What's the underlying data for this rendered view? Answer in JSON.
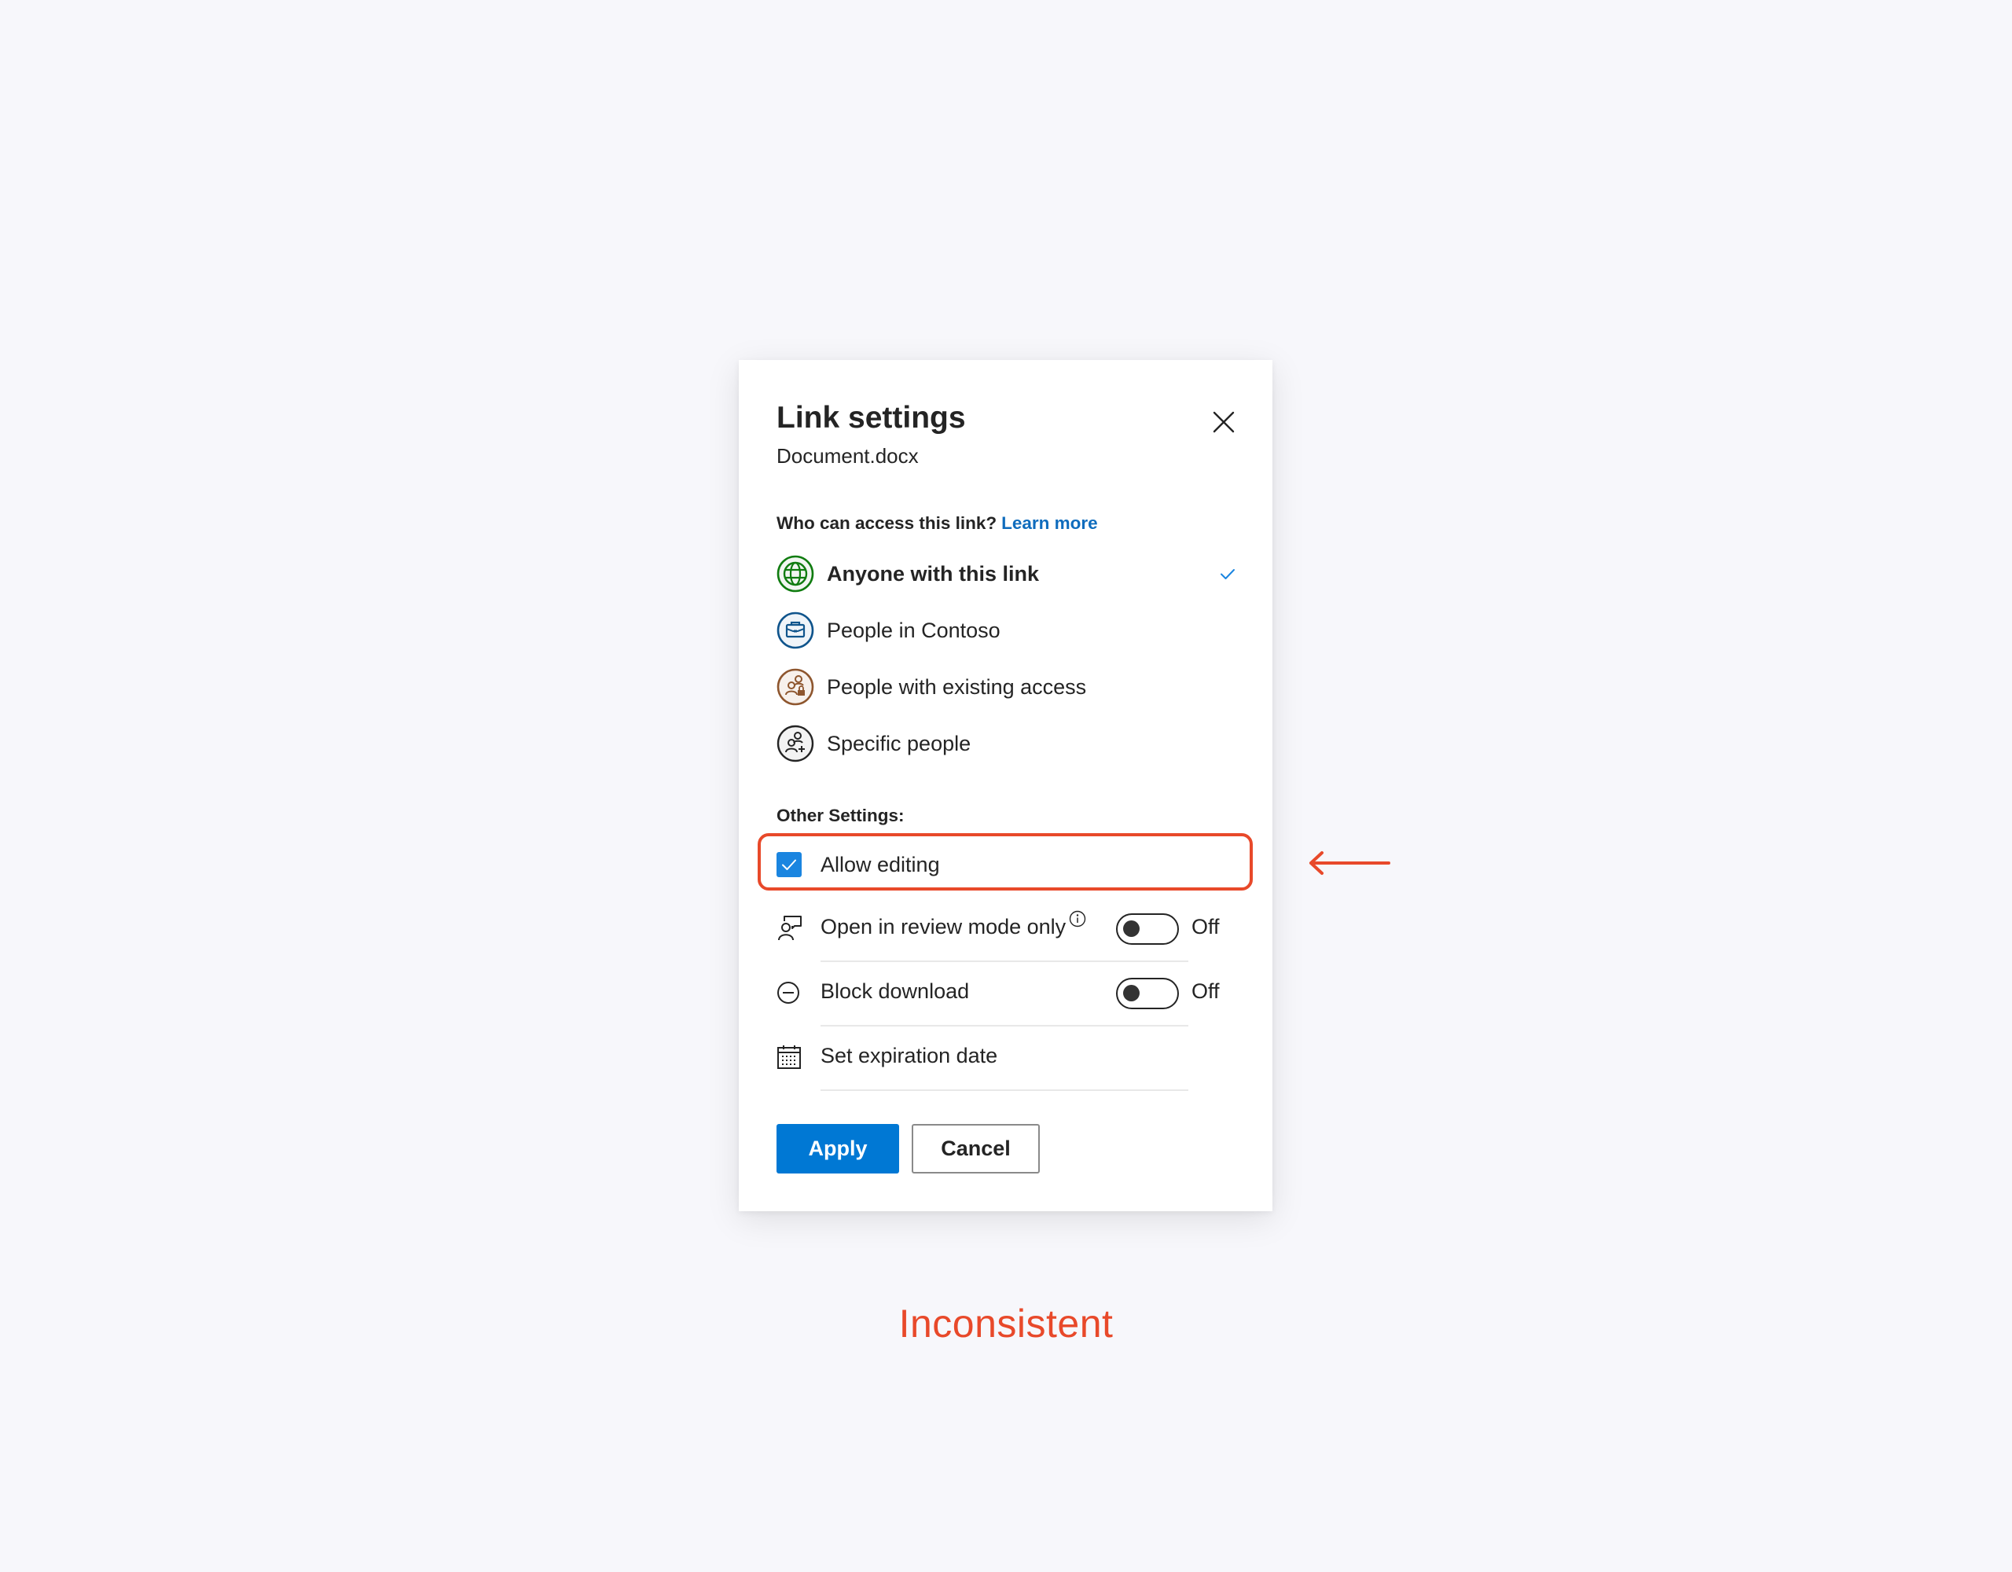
{
  "dialog": {
    "title": "Link settings",
    "filename": "Document.docx",
    "close_icon": "close-icon",
    "access_question": "Who can access this link?",
    "learn_more": "Learn more",
    "access_options": [
      {
        "label": "Anyone with this link",
        "icon": "globe-icon",
        "selected": true,
        "color": "#107c10"
      },
      {
        "label": "People in Contoso",
        "icon": "briefcase-icon",
        "selected": false,
        "color": "#0f548c"
      },
      {
        "label": "People with existing access",
        "icon": "people-lock-icon",
        "selected": false,
        "color": "#8e562e"
      },
      {
        "label": "Specific people",
        "icon": "people-add-icon",
        "selected": false,
        "color": "#242424"
      }
    ],
    "other_settings_label": "Other Settings:",
    "allow_editing": {
      "label": "Allow editing",
      "checked": true
    },
    "settings": [
      {
        "label": "Open in review mode only",
        "icon": "person-feedback-icon",
        "has_info": true,
        "toggle": true,
        "state": "Off"
      },
      {
        "label": "Block download",
        "icon": "block-icon",
        "has_info": false,
        "toggle": true,
        "state": "Off"
      },
      {
        "label": "Set expiration date",
        "icon": "calendar-icon",
        "has_info": false,
        "toggle": false,
        "state": null
      }
    ],
    "apply_label": "Apply",
    "cancel_label": "Cancel"
  },
  "annotation": {
    "caption": "Inconsistent",
    "arrow": "arrow-left-icon",
    "color": "#e8492a"
  },
  "colors": {
    "accent": "#0078d4",
    "link": "#0f6cbd",
    "checkbox": "#1a85e0",
    "highlight": "#e8492a",
    "background": "#f7f7fb"
  }
}
